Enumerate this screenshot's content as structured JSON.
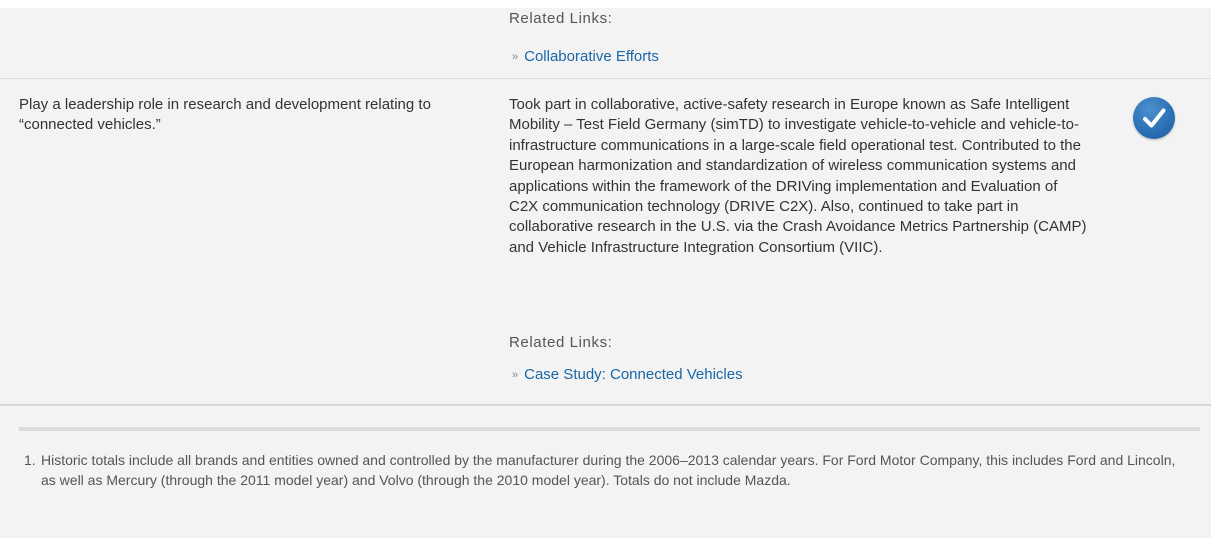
{
  "rows": [
    {
      "related_label": "Related Links:",
      "links": [
        "Collaborative Efforts"
      ]
    },
    {
      "commitment": "Play a leadership role in research and development relating to “connected vehicles.”",
      "progress": "Took part in collaborative, active-safety research in Europe known as Safe Intelligent Mobility – Test Field Germany (simTD) to investigate vehicle-to-vehicle and vehicle-to-infrastructure communications in a large-scale field operational test. Contributed to the European harmonization and standardization of wireless communication systems and applications within the framework of the DRIVing implementation and Evaluation of C2X communication technology (DRIVE C2X). Also, continued to take part in collaborative research in the U.S. via the Crash Avoidance Metrics Partnership (CAMP) and Vehicle Infrastructure Integration Consortium (VIIC).",
      "status_icon": "checkmark-circle-icon",
      "related_label": "Related Links:",
      "links": [
        "Case Study: Connected Vehicles"
      ]
    }
  ],
  "footnotes": [
    {
      "number": "1.",
      "text": "Historic totals include all brands and entities owned and controlled by the manufacturer during the 2006–2013 calendar years. For Ford Motor Company, this includes Ford and Lincoln, as well as Mercury (through the 2011 model year) and Volvo (through the 2010 model year). Totals do not include Mazda."
    }
  ],
  "colors": {
    "link": "#1a66a6",
    "status_badge": "#2a6fb3",
    "row_background": "#f3f3f3"
  }
}
